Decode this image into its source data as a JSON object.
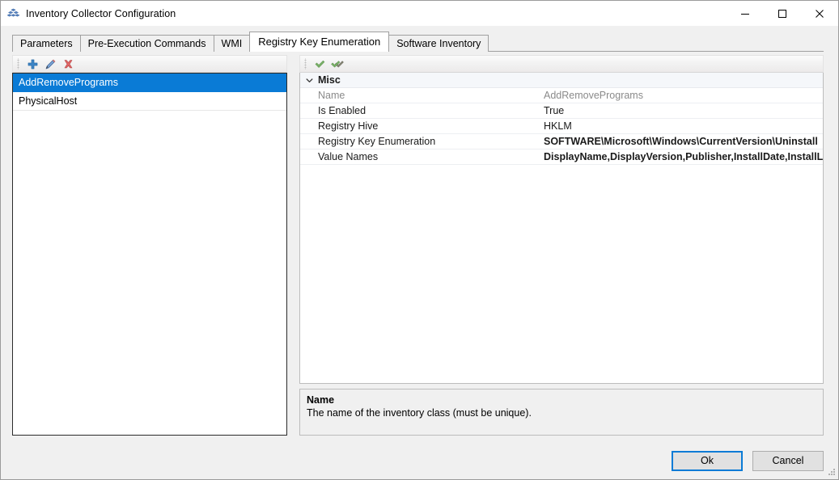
{
  "window": {
    "title": "Inventory Collector Configuration",
    "icon": "app-cubes-icon",
    "minimize_label": "─",
    "maximize_label": "□",
    "close_label": "✕"
  },
  "tabs": [
    {
      "label": "Parameters",
      "active": false
    },
    {
      "label": "Pre-Execution Commands",
      "active": false
    },
    {
      "label": "WMI",
      "active": false
    },
    {
      "label": "Registry Key Enumeration",
      "active": true
    },
    {
      "label": "Software Inventory",
      "active": false
    }
  ],
  "left_toolbar": {
    "buttons": [
      {
        "name": "add-button",
        "icon": "plus-icon",
        "color": "#3d85c6"
      },
      {
        "name": "edit-button",
        "icon": "pencil-icon",
        "color": "#4a7ebb"
      },
      {
        "name": "delete-button",
        "icon": "red-x-icon",
        "color": "#e06666"
      }
    ]
  },
  "right_toolbar": {
    "buttons": [
      {
        "name": "check-button",
        "icon": "check-icon",
        "color": "#6aa84f"
      },
      {
        "name": "check-all-button",
        "icon": "double-check-icon",
        "color": "#6aa84f"
      }
    ]
  },
  "list": {
    "items": [
      {
        "label": "AddRemovePrograms",
        "selected": true
      },
      {
        "label": "PhysicalHost",
        "selected": false
      }
    ]
  },
  "property_grid": {
    "category": "Misc",
    "category_expanded": true,
    "rows": [
      {
        "name": "Name",
        "value": "AddRemovePrograms",
        "readonly": true,
        "bold_value": false
      },
      {
        "name": "Is Enabled",
        "value": "True",
        "readonly": false,
        "bold_value": false
      },
      {
        "name": "Registry Hive",
        "value": "HKLM",
        "readonly": false,
        "bold_value": false
      },
      {
        "name": "Registry Key Enumeration",
        "value": "SOFTWARE\\Microsoft\\Windows\\CurrentVersion\\Uninstall",
        "readonly": false,
        "bold_value": true
      },
      {
        "name": "Value Names",
        "value": "DisplayName,DisplayVersion,Publisher,InstallDate,InstallLocation",
        "readonly": false,
        "bold_value": true
      }
    ]
  },
  "description": {
    "title": "Name",
    "text": "The name of the inventory class (must be unique)."
  },
  "footer": {
    "ok_label": "Ok",
    "cancel_label": "Cancel"
  },
  "colors": {
    "selection_blue": "#0a7bd6",
    "window_bg": "#f0f0f0",
    "category_bg": "#f5f7fa"
  }
}
